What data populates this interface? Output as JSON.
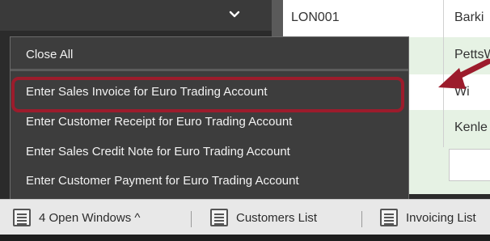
{
  "grid": {
    "rows": [
      {
        "code": "LON001",
        "name": "Barki"
      },
      {
        "code": "",
        "name": "PettsW"
      },
      {
        "code": "",
        "name": "Wi"
      },
      {
        "code": "",
        "name": "Kenle"
      }
    ]
  },
  "menu": {
    "items": [
      {
        "label": "Close All"
      },
      {
        "label": "Enter Sales Invoice for Euro Trading Account"
      },
      {
        "label": "Enter Customer Receipt for Euro Trading Account"
      },
      {
        "label": "Enter Sales Credit Note for Euro Trading Account"
      },
      {
        "label": "Enter Customer Payment for Euro Trading Account"
      }
    ]
  },
  "taskbar": {
    "open_windows": "4 Open Windows ^",
    "customers_list": "Customers List",
    "invoicing_list": "Invoicing List"
  },
  "icons": {
    "dropdown": "chevron-down-icon",
    "window_stack": "windows-icon",
    "list": "list-icon"
  },
  "colors": {
    "highlight": "#9c1c2c",
    "menu_bg": "#3d3d3d",
    "row_alt": "#e6f2e4"
  }
}
